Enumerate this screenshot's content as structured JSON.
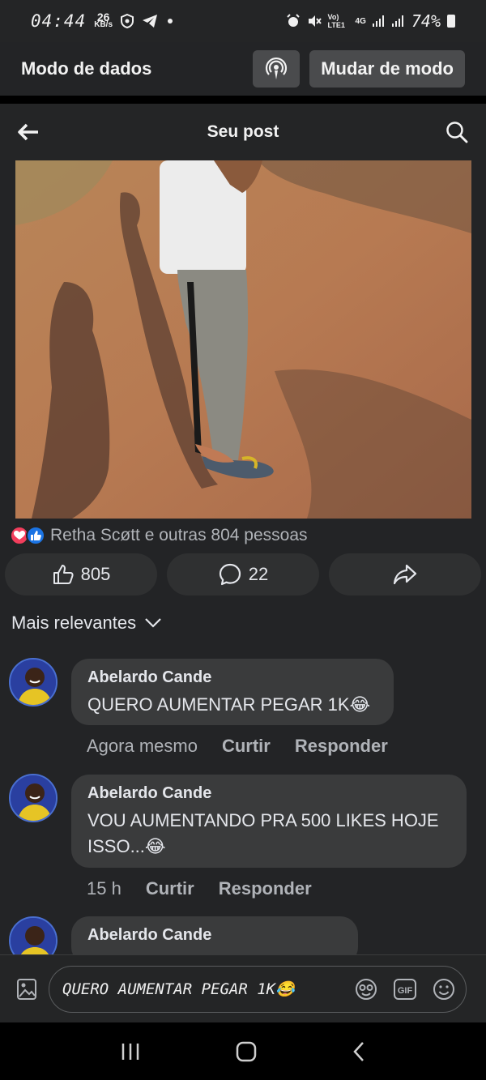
{
  "status_bar": {
    "time": "04:44",
    "speed_value": "26",
    "speed_unit": "KB/s",
    "network_label": "Vo) LTE1",
    "network_type": "4G",
    "battery": "74%"
  },
  "data_mode": {
    "title": "Modo de dados",
    "switch_label": "Mudar de modo"
  },
  "post_header": {
    "title": "Seu post"
  },
  "reactions": {
    "text": "Retha Scøtt e outras 804 pessoas"
  },
  "actions": {
    "like_count": "805",
    "comment_count": "22"
  },
  "sort": {
    "label": "Mais relevantes"
  },
  "comments": [
    {
      "author": "Abelardo Cande",
      "text": "QUERO AUMENTAR PEGAR 1K😂",
      "time": "Agora mesmo",
      "like_label": "Curtir",
      "reply_label": "Responder"
    },
    {
      "author": "Abelardo Cande",
      "text": "VOU AUMENTANDO PRA 500 LIKES HOJE ISSO...😂",
      "time": "15 h",
      "like_label": "Curtir",
      "reply_label": "Responder"
    },
    {
      "author": "Abelardo Cande"
    }
  ],
  "composer": {
    "text": "QUERO AUMENTAR PEGAR 1K😂"
  },
  "colors": {
    "background": "#232426",
    "bubble": "#3a3b3c",
    "like_blue": "#1b74e4",
    "heart_red": "#f23e5c"
  },
  "icons": [
    "back-arrow-icon",
    "search-icon",
    "podcast-icon",
    "thumbs-up-icon",
    "comment-icon",
    "share-icon",
    "chevron-down-icon",
    "gallery-icon",
    "sticker-icon",
    "gif-icon",
    "emoji-icon"
  ]
}
